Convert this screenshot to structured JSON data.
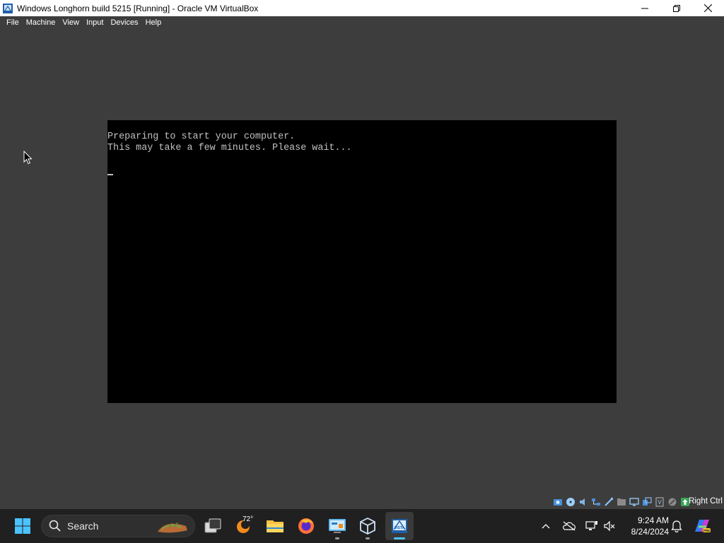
{
  "window": {
    "title": "Windows Longhorn build 5215 [Running] - Oracle VM VirtualBox",
    "controls": [
      "minimize-icon",
      "maximize-icon",
      "close-icon"
    ]
  },
  "menu": {
    "file": "File",
    "machine": "Machine",
    "view": "View",
    "input": "Input",
    "devices": "Devices",
    "help": "Help"
  },
  "vm": {
    "console_line1": "Preparing to start your computer.",
    "console_line2": "This may take a few minutes. Please wait..."
  },
  "statusbar": {
    "icons": [
      "hard-disk-icon",
      "optical-drive-icon",
      "audio-icon",
      "network-icon",
      "usb-icon",
      "shared-folders-icon",
      "display-icon",
      "recording-icon",
      "cpu-icon",
      "mouse-integration-icon",
      "keyboard-icon"
    ],
    "host_key": "Right Ctrl"
  },
  "taskbar": {
    "search_label": "Search",
    "weather_temp": "72°",
    "time": "9:24 AM",
    "date": "8/24/2024",
    "accent": "#4cc2ff"
  }
}
